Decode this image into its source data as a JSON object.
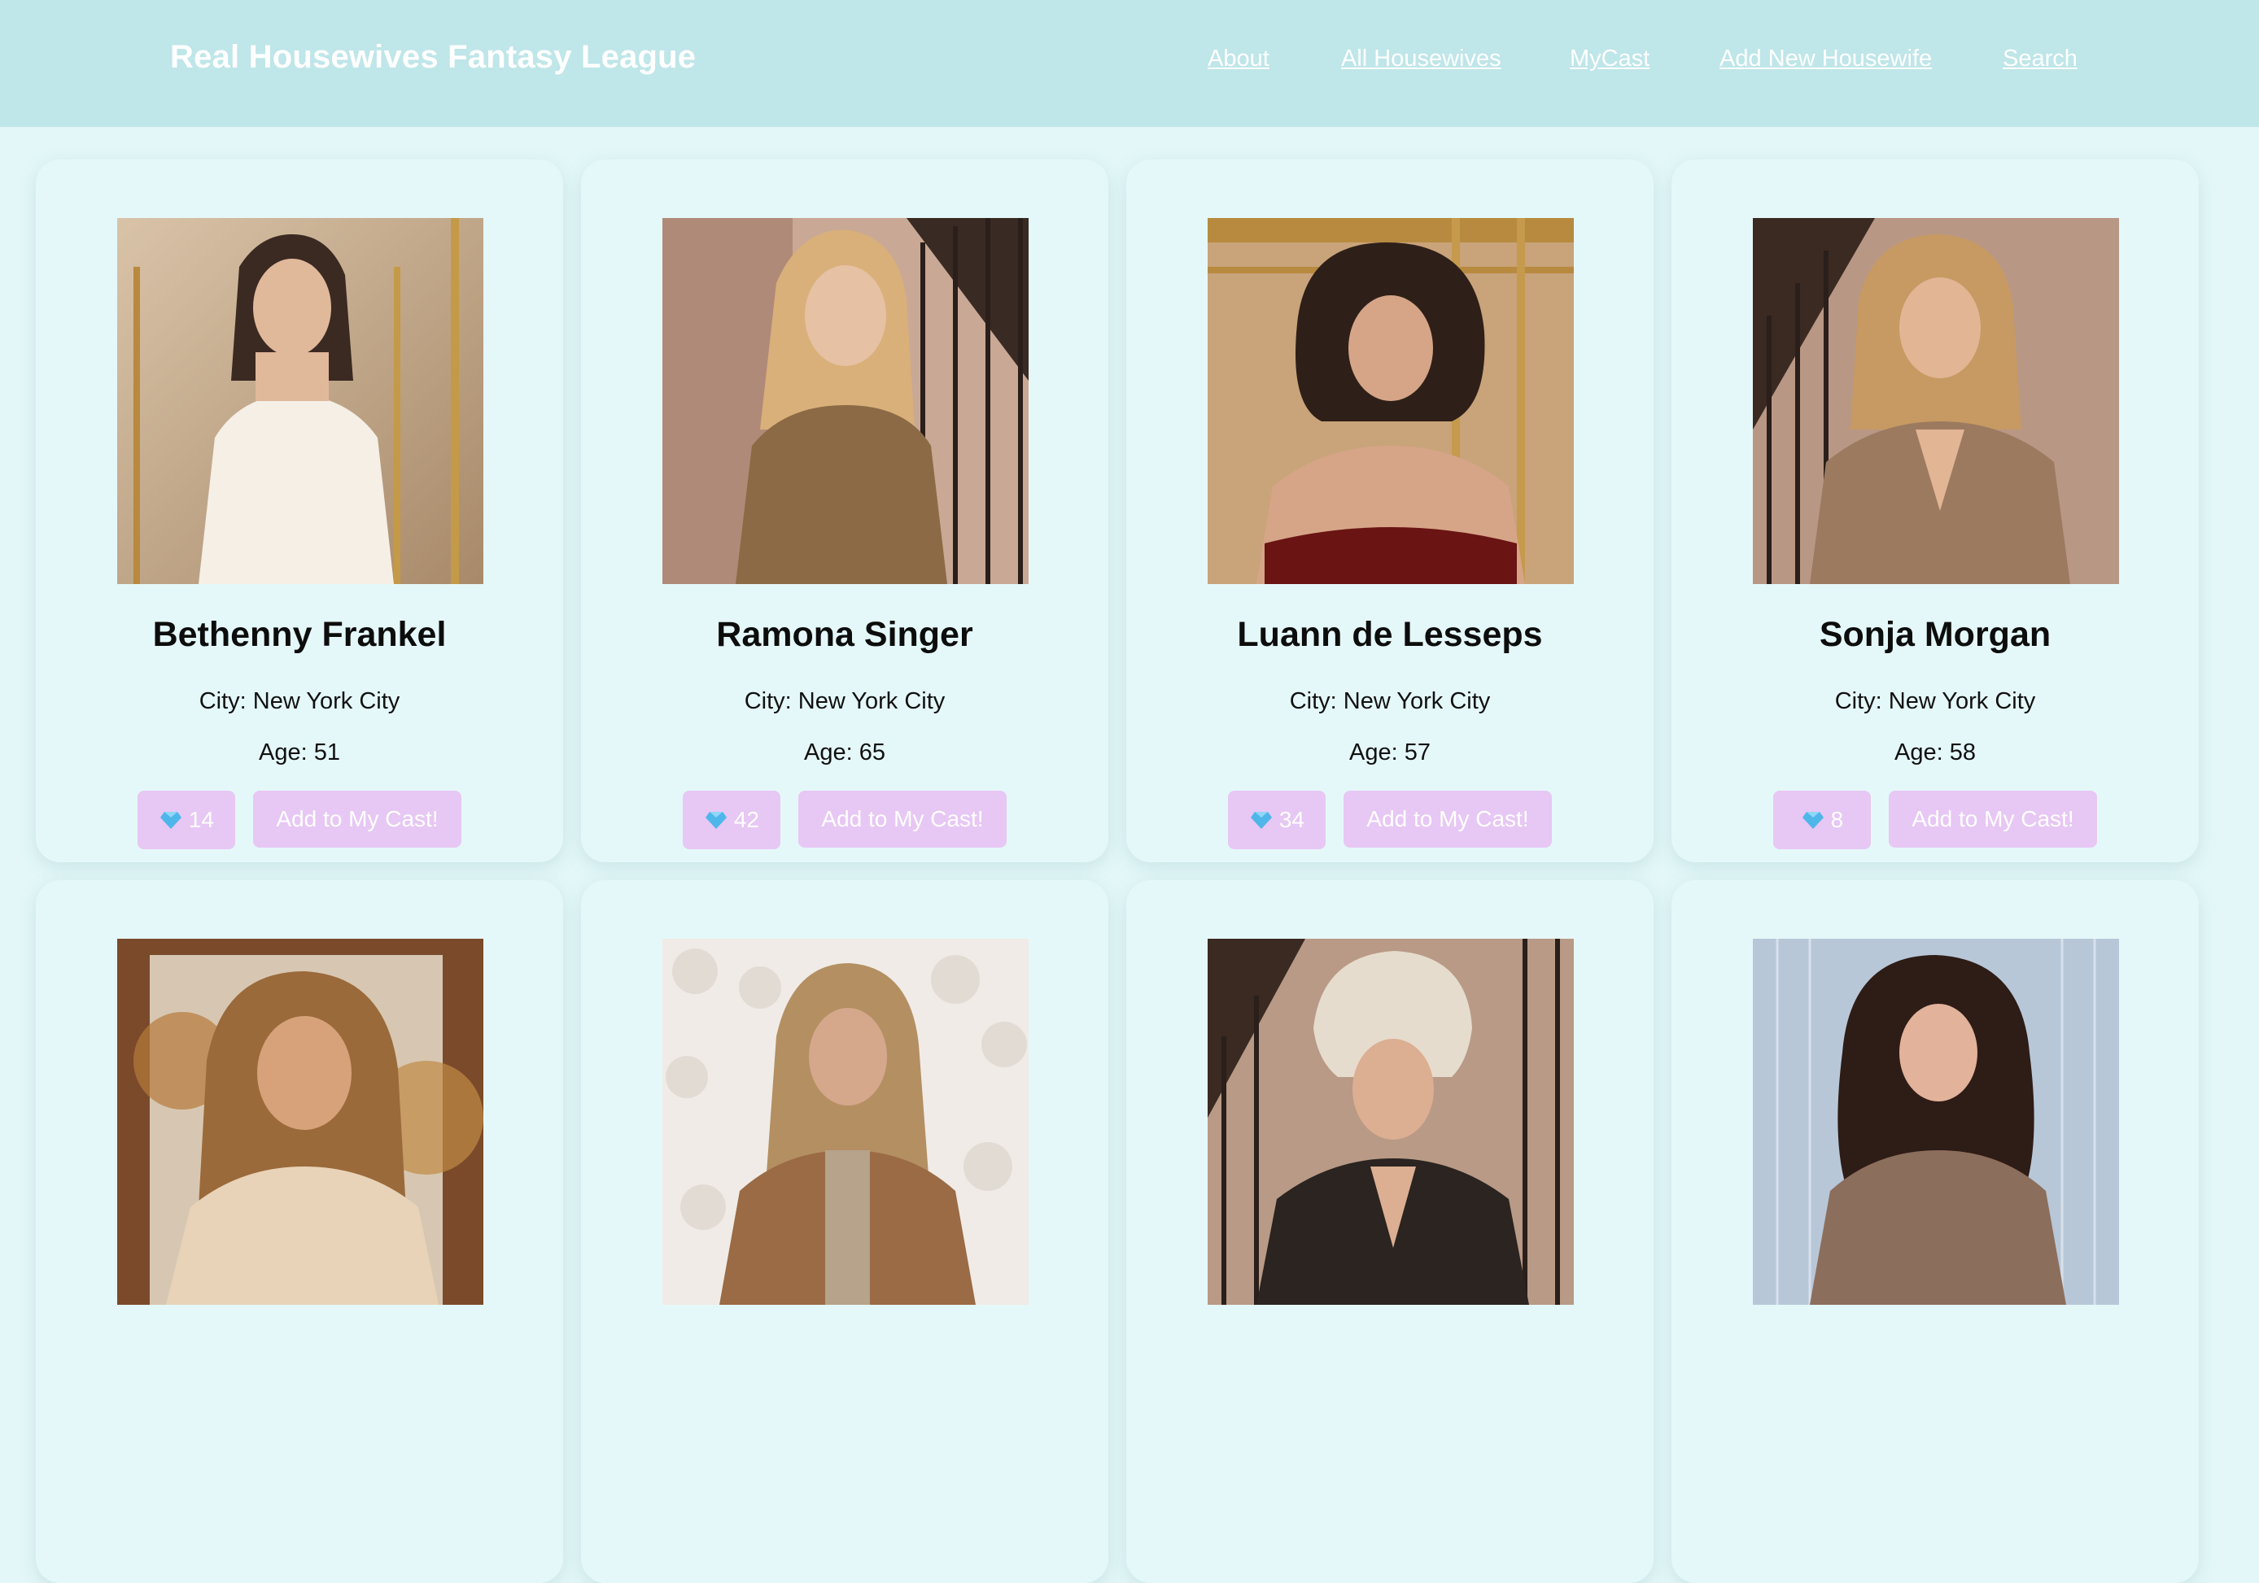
{
  "header": {
    "title": "Real Housewives Fantasy League",
    "nav": [
      "About",
      "All Housewives",
      "MyCast",
      "Add New Housewife",
      "Search"
    ]
  },
  "cards": [
    {
      "name": "Bethenny Frankel",
      "city": "City: New York City",
      "age": "Age: 51",
      "score": "14",
      "add_label": "Add to My Cast!"
    },
    {
      "name": "Ramona Singer",
      "city": "City: New York City",
      "age": "Age: 65",
      "score": "42",
      "add_label": "Add to My Cast!"
    },
    {
      "name": "Luann de Lesseps",
      "city": "City: New York City",
      "age": "Age: 57",
      "score": "34",
      "add_label": "Add to My Cast!"
    },
    {
      "name": "Sonja Morgan",
      "city": "City: New York City",
      "age": "Age: 58",
      "score": "8",
      "add_label": "Add to My Cast!"
    },
    {},
    {},
    {},
    {}
  ],
  "colors": {
    "background": "#e3f7f8",
    "header": "#bfe6e9",
    "card": "#e5f8f9",
    "button": "#e7c7f4",
    "gem": "#4fb6ea"
  },
  "icons": {
    "score": "gem-icon"
  }
}
